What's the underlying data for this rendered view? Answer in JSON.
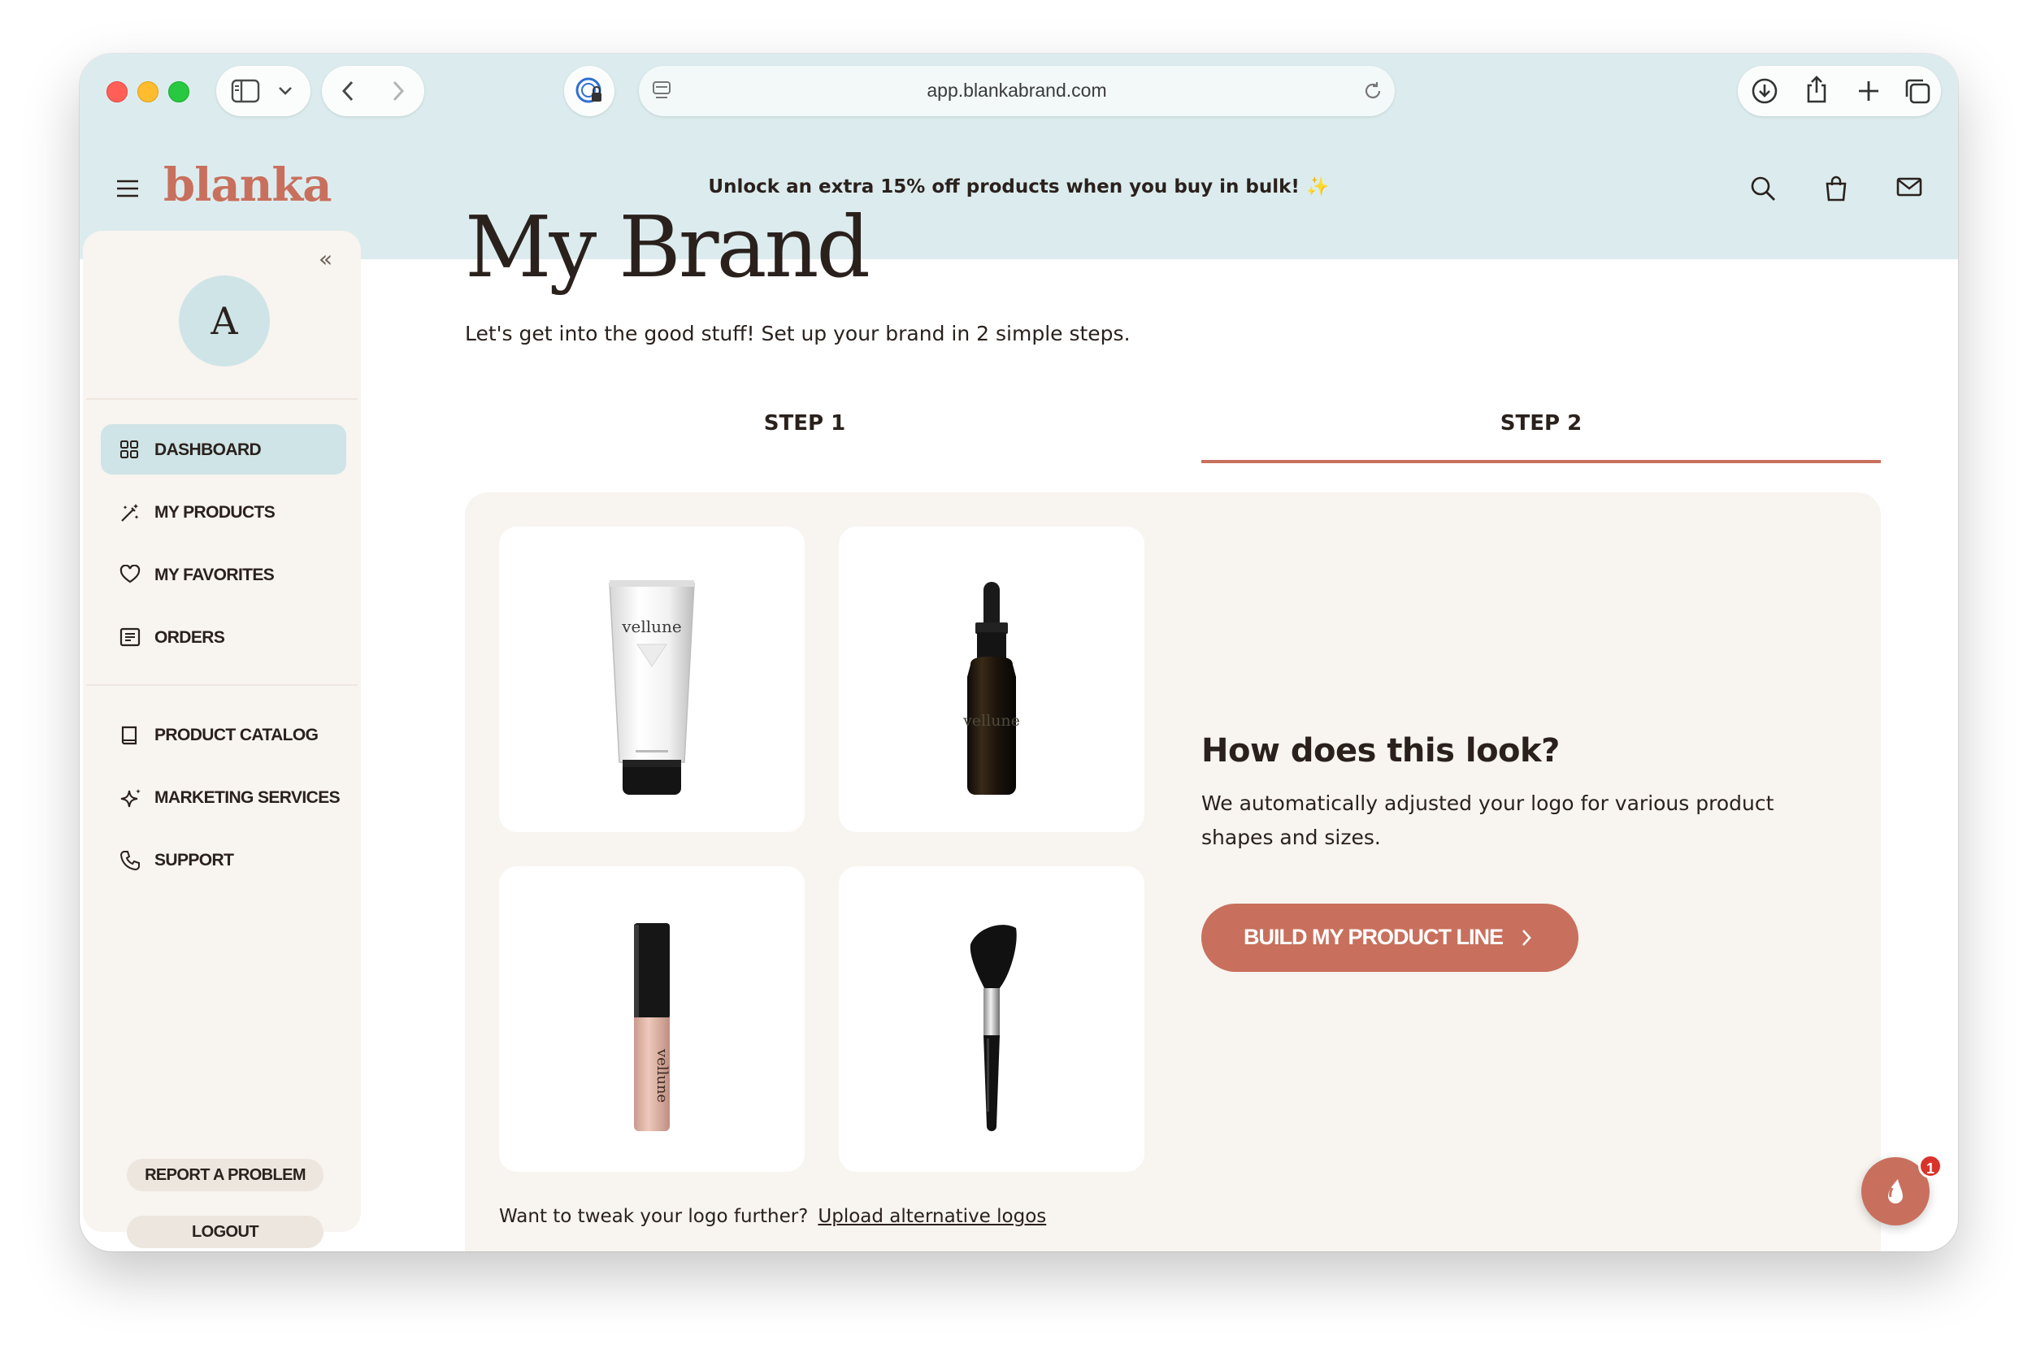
{
  "browser": {
    "url": "app.blankabrand.com"
  },
  "header": {
    "logo": "blanka",
    "promo": "Unlock an extra 15% off products when you buy in bulk!",
    "promo_emoji": "✨"
  },
  "sidebar": {
    "avatar_initial": "A",
    "nav": [
      {
        "label": "DASHBOARD",
        "icon": "grid-icon",
        "active": true
      },
      {
        "label": "MY PRODUCTS",
        "icon": "magic-wand-icon",
        "active": false
      },
      {
        "label": "MY FAVORITES",
        "icon": "heart-icon",
        "active": false
      },
      {
        "label": "ORDERS",
        "icon": "receipt-icon",
        "active": false
      },
      {
        "label": "PRODUCT CATALOG",
        "icon": "book-icon",
        "active": false
      },
      {
        "label": "MARKETING SERVICES",
        "icon": "sparkle-icon",
        "active": false
      },
      {
        "label": "SUPPORT",
        "icon": "phone-icon",
        "active": false
      }
    ],
    "report_label": "REPORT A PROBLEM",
    "logout_label": "LOGOUT"
  },
  "main": {
    "title": "My Brand",
    "subtitle": "Let's get into the good stuff! Set up your brand in 2 simple steps.",
    "steps": [
      {
        "label": "STEP 1",
        "active": false
      },
      {
        "label": "STEP 2",
        "active": true
      }
    ],
    "products": [
      {
        "name": "tube",
        "brand_text": "vellune"
      },
      {
        "name": "dropper-bottle",
        "brand_text": "vellune"
      },
      {
        "name": "lip-gloss",
        "brand_text": "vellune"
      },
      {
        "name": "makeup-brush",
        "brand_text": ""
      }
    ],
    "look_title": "How does this look?",
    "look_text": "We automatically adjusted your logo for various product shapes and sizes.",
    "cta_label": "BUILD MY PRODUCT LINE",
    "tweak_text": "Want to tweak your logo further?",
    "tweak_link": "Upload alternative logos"
  },
  "chat": {
    "badge": "1"
  },
  "colors": {
    "accent": "#c8705d",
    "header_bg": "#dcecee",
    "sidebar_bg": "#f8f4f0",
    "text": "#2a211d"
  }
}
